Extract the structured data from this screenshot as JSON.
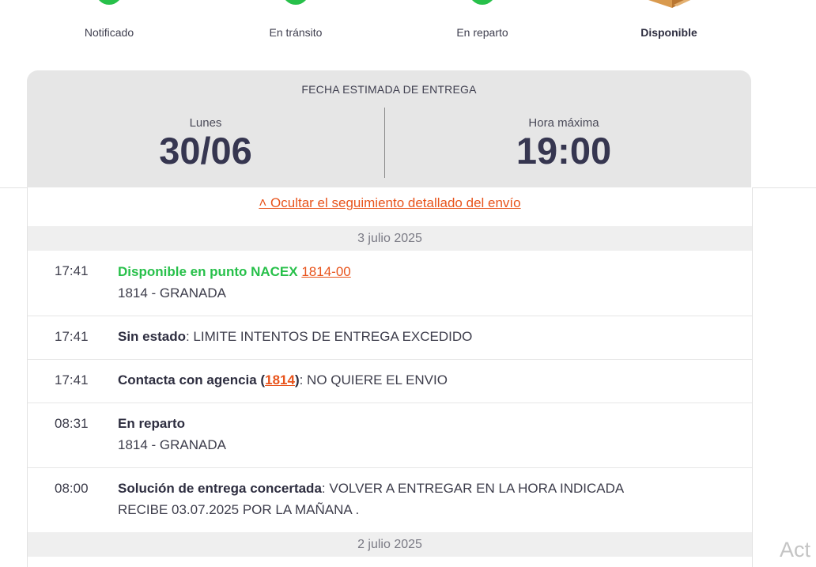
{
  "steps": [
    {
      "label": "Notificado",
      "state": "done"
    },
    {
      "label": "En tránsito",
      "state": "done"
    },
    {
      "label": "En reparto",
      "state": "done"
    },
    {
      "label": "Disponible",
      "state": "current"
    }
  ],
  "delivery": {
    "caption": "FECHA ESTIMADA DE ENTREGA",
    "day_label": "Lunes",
    "date": "30/06",
    "time_label": "Hora máxima",
    "time": "19:00"
  },
  "tracking": {
    "toggle_label": "˄ Ocultar el seguimiento detallado del envío",
    "groups": [
      {
        "date": "3 julio 2025",
        "events": [
          {
            "time": "17:41",
            "status": "Disponible en punto NACEX",
            "link": " 1814-00",
            "line2": "1814 - GRANADA"
          },
          {
            "time": "17:41",
            "status": "Sin estado",
            "detail": ": LIMITE INTENTOS DE ENTREGA EXCEDIDO"
          },
          {
            "time": "17:41",
            "status_prefix": "Contacta con agencia (",
            "link": "1814",
            "status_suffix": ")",
            "detail": ": NO QUIERE EL ENVIO"
          },
          {
            "time": "08:31",
            "status": "En reparto",
            "line2": "1814 - GRANADA"
          },
          {
            "time": "08:00",
            "status": "Solución de entrega concertada",
            "detail": ": VOLVER A ENTREGAR EN LA HORA INDICADA",
            "line2": "RECIBE 03.07.2025 POR LA MAÑANA ."
          }
        ]
      },
      {
        "date": "2 julio 2025",
        "events": []
      }
    ]
  },
  "colors": {
    "green": "#27c04a",
    "accent": "#e8541c",
    "panel": "#e6e6e6"
  },
  "watermark": "Act"
}
